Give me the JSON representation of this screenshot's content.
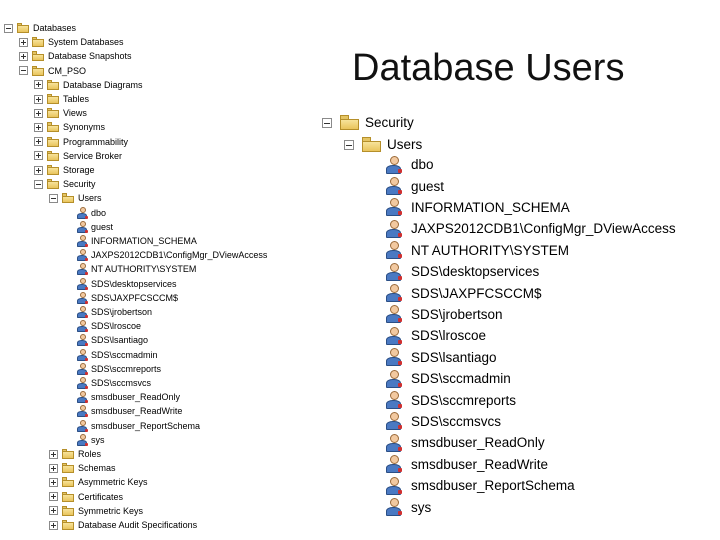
{
  "slide_title": "Database Users",
  "left_tree": {
    "nodes": [
      {
        "label": "Databases",
        "expander": "minus",
        "icon": "folder"
      },
      {
        "label": "System Databases",
        "expander": "plus",
        "icon": "folder"
      },
      {
        "label": "Database Snapshots",
        "expander": "plus",
        "icon": "folder"
      },
      {
        "label": "CM_PSO",
        "expander": "minus",
        "icon": "database"
      },
      {
        "label": "Database Diagrams",
        "expander": "plus",
        "icon": "folder"
      },
      {
        "label": "Tables",
        "expander": "plus",
        "icon": "folder"
      },
      {
        "label": "Views",
        "expander": "plus",
        "icon": "folder"
      },
      {
        "label": "Synonyms",
        "expander": "plus",
        "icon": "folder"
      },
      {
        "label": "Programmability",
        "expander": "plus",
        "icon": "folder"
      },
      {
        "label": "Service Broker",
        "expander": "plus",
        "icon": "folder"
      },
      {
        "label": "Storage",
        "expander": "plus",
        "icon": "folder"
      },
      {
        "label": "Security",
        "expander": "minus",
        "icon": "folder"
      },
      {
        "label": "Users",
        "expander": "minus",
        "icon": "folder"
      },
      {
        "label": "dbo",
        "expander": "none",
        "icon": "user"
      },
      {
        "label": "guest",
        "expander": "none",
        "icon": "user"
      },
      {
        "label": "INFORMATION_SCHEMA",
        "expander": "none",
        "icon": "user"
      },
      {
        "label": "JAXPS2012CDB1\\ConfigMgr_DViewAccess",
        "expander": "none",
        "icon": "user"
      },
      {
        "label": "NT AUTHORITY\\SYSTEM",
        "expander": "none",
        "icon": "user"
      },
      {
        "label": "SDS\\desktopservices",
        "expander": "none",
        "icon": "user"
      },
      {
        "label": "SDS\\JAXPFCSCCM$",
        "expander": "none",
        "icon": "user"
      },
      {
        "label": "SDS\\jrobertson",
        "expander": "none",
        "icon": "user"
      },
      {
        "label": "SDS\\lroscoe",
        "expander": "none",
        "icon": "user"
      },
      {
        "label": "SDS\\lsantiago",
        "expander": "none",
        "icon": "user"
      },
      {
        "label": "SDS\\sccmadmin",
        "expander": "none",
        "icon": "user"
      },
      {
        "label": "SDS\\sccmreports",
        "expander": "none",
        "icon": "user"
      },
      {
        "label": "SDS\\sccmsvcs",
        "expander": "none",
        "icon": "user"
      },
      {
        "label": "smsdbuser_ReadOnly",
        "expander": "none",
        "icon": "user"
      },
      {
        "label": "smsdbuser_ReadWrite",
        "expander": "none",
        "icon": "user"
      },
      {
        "label": "smsdbuser_ReportSchema",
        "expander": "none",
        "icon": "user"
      },
      {
        "label": "sys",
        "expander": "none",
        "icon": "user"
      },
      {
        "label": "Roles",
        "expander": "plus",
        "icon": "folder"
      },
      {
        "label": "Schemas",
        "expander": "plus",
        "icon": "folder"
      },
      {
        "label": "Asymmetric Keys",
        "expander": "plus",
        "icon": "folder"
      },
      {
        "label": "Certificates",
        "expander": "plus",
        "icon": "folder"
      },
      {
        "label": "Symmetric Keys",
        "expander": "plus",
        "icon": "folder"
      },
      {
        "label": "Database Audit Specifications",
        "expander": "plus",
        "icon": "folder"
      }
    ]
  },
  "right_tree": {
    "security_label": "Security",
    "users_label": "Users",
    "users": [
      "dbo",
      "guest",
      "INFORMATION_SCHEMA",
      "JAXPS2012CDB1\\ConfigMgr_DViewAccess",
      "NT AUTHORITY\\SYSTEM",
      "SDS\\desktopservices",
      "SDS\\JAXPFCSCCM$",
      "SDS\\jrobertson",
      "SDS\\lroscoe",
      "SDS\\lsantiago",
      "SDS\\sccmadmin",
      "SDS\\sccmreports",
      "SDS\\sccmsvcs",
      "smsdbuser_ReadOnly",
      "smsdbuser_ReadWrite",
      "smsdbuser_ReportSchema",
      "sys"
    ]
  },
  "colors": {
    "folder": "#e9c45c",
    "user_body": "#4a79c2",
    "user_head": "#f2c9a0"
  }
}
